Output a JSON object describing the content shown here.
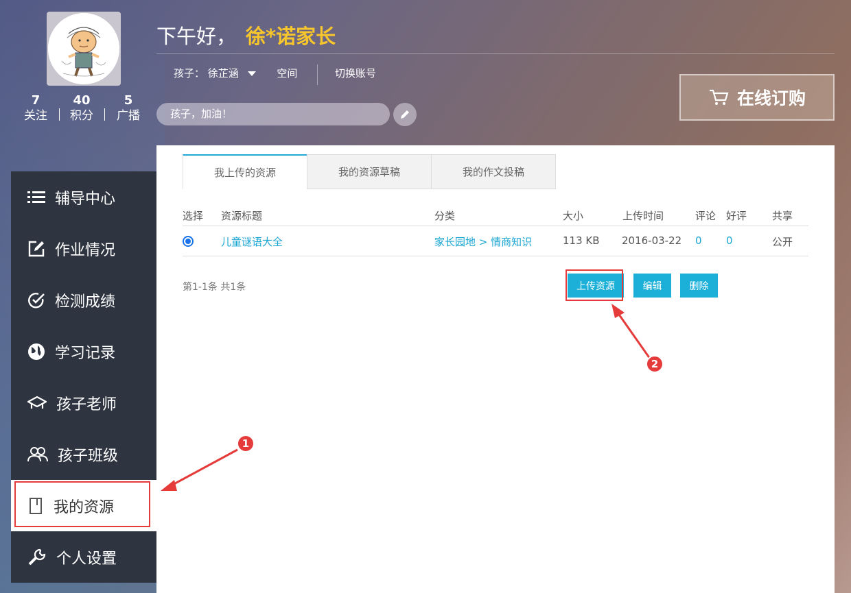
{
  "profile": {
    "greeting": "下午好，",
    "name": "徐*诺家长",
    "stats": [
      {
        "num": "7",
        "label": "关注"
      },
      {
        "num": "40",
        "label": "积分"
      },
      {
        "num": "5",
        "label": "广播"
      }
    ],
    "child_label": "孩子：",
    "child_name": "徐芷涵",
    "space": "空间",
    "switch_account": "切换账号",
    "motto": "孩子，加油！"
  },
  "buy_button": "在线订购",
  "sidebar": {
    "items": [
      {
        "label": "辅导中心",
        "icon": "list-icon"
      },
      {
        "label": "作业情况",
        "icon": "edit-icon"
      },
      {
        "label": "检测成绩",
        "icon": "check-circle-icon"
      },
      {
        "label": "学习记录",
        "icon": "globe-icon"
      },
      {
        "label": "孩子老师",
        "icon": "graduation-cap-icon"
      },
      {
        "label": "孩子班级",
        "icon": "users-icon"
      },
      {
        "label": "我的资源",
        "icon": "book-icon"
      },
      {
        "label": "个人设置",
        "icon": "wrench-icon"
      }
    ]
  },
  "tabs": [
    "我上传的资源",
    "我的资源草稿",
    "我的作文投稿"
  ],
  "table": {
    "headers": [
      "选择",
      "资源标题",
      "分类",
      "大小",
      "上传时间",
      "评论",
      "好评",
      "共享"
    ],
    "rows": [
      {
        "title": "儿童谜语大全",
        "category": "家长园地 > 情商知识",
        "size": "113 KB",
        "date": "2016-03-22",
        "comments": "0",
        "likes": "0",
        "share": "公开"
      }
    ]
  },
  "paging": "第1-1条 共1条",
  "actions": {
    "upload": "上传资源",
    "edit": "编辑",
    "delete": "删除"
  },
  "annotations": {
    "badge1": "1",
    "badge2": "2"
  },
  "colors": {
    "accent": "#1cb0d8",
    "highlight": "#e53b3b",
    "name": "#f7c52c",
    "sidebar": "#2e3440"
  }
}
